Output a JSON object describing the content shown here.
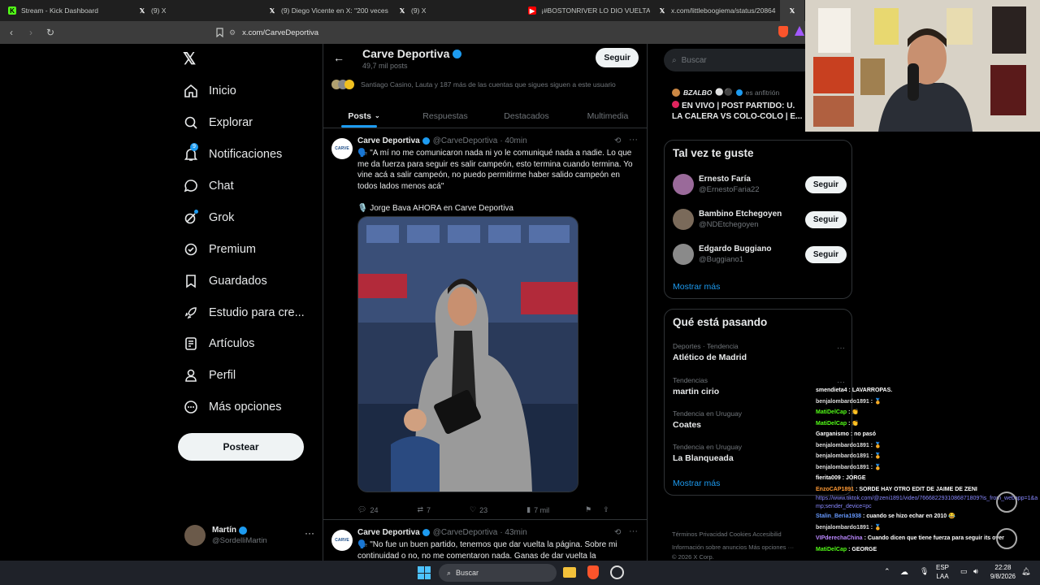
{
  "browser": {
    "tabs": [
      {
        "label": "Stream - Kick Dashboard",
        "icon": "K",
        "color": "#53fc18"
      },
      {
        "label": "(9) X",
        "icon": "X",
        "color": "#000000"
      },
      {
        "label": "(9) Diego Vicente en X: \"200 veces",
        "icon": "X",
        "color": "#000000"
      },
      {
        "label": "(9) X",
        "icon": "X",
        "color": "#000000"
      },
      {
        "label": "¡#BOSTONRIVER LO DIO VUELTA en",
        "icon": "▶",
        "color": "#ff0000"
      },
      {
        "label": "x.com/littleboogiema/status/20864",
        "icon": "X",
        "color": "#000000"
      }
    ],
    "url": "x.com/CarveDeportiva"
  },
  "nav": {
    "items": [
      {
        "label": "Inicio",
        "icon": "home-icon"
      },
      {
        "label": "Explorar",
        "icon": "search-icon"
      },
      {
        "label": "Notificaciones",
        "icon": "bell-icon"
      },
      {
        "label": "Chat",
        "icon": "chat-icon"
      },
      {
        "label": "Grok",
        "icon": "grok-icon"
      },
      {
        "label": "Premium",
        "icon": "premium-icon"
      },
      {
        "label": "Guardados",
        "icon": "bookmark-icon"
      },
      {
        "label": "Estudio para cre...",
        "icon": "rocket-icon"
      },
      {
        "label": "Artículos",
        "icon": "article-icon"
      },
      {
        "label": "Perfil",
        "icon": "person-icon"
      },
      {
        "label": "Más opciones",
        "icon": "more-icon"
      }
    ],
    "notif_badge": "9",
    "post_label": "Postear",
    "user_name": "Martín",
    "user_handle": "@SordelliMartin"
  },
  "profile": {
    "name": "Carve Deportiva",
    "posts_count": "49,7 mil posts",
    "follow_label": "Seguir",
    "followers_note": "Santiago Casino, Lauta y 187 más de las cuentas que sigues siguen a este usuario",
    "tabs": [
      "Posts",
      "Respuestas",
      "Destacados",
      "Multimedia"
    ]
  },
  "tweets": [
    {
      "name": "Carve Deportiva",
      "handle": "@CarveDeportiva",
      "time": "· 40min",
      "text": "🗣️ \"A mí no me comunicaron nada ni yo le comuniqué nada a nadie. Lo que me da fuerza para seguir es salir campeón, esto termina cuando termina. Yo vine acá a salir campeón, no puedo permitirme haber salido campeón en todos lados menos acá\"",
      "text2": "🎙️ Jorge Bava AHORA en Carve Deportiva",
      "replies": "24",
      "retweets": "7",
      "likes": "23",
      "views": "7 mil"
    },
    {
      "name": "Carve Deportiva",
      "handle": "@CarveDeportiva",
      "time": "· 43min",
      "text": "🗣️ \"No fue un buen partido, tenemos que dar vuelta la página. Sobre mi continuidad o no, no me comentaron nada. Ganas de dar vuelta la"
    }
  ],
  "sidebar": {
    "search_placeholder": "Buscar",
    "live": {
      "host": "BZALBO",
      "host_note": "es anfitrión",
      "title": "EN VIVO | POST PARTIDO: U. LA CALERA VS COLO-COLO | E..."
    },
    "suggestions_title": "Tal vez te guste",
    "suggestions": [
      {
        "name": "Ernesto Faría",
        "handle": "@ErnestoFaria22",
        "follow": "Seguir"
      },
      {
        "name": "Bambino Etchegoyen",
        "handle": "@NDEtchegoyen",
        "follow": "Seguir"
      },
      {
        "name": "Edgardo Buggiano",
        "handle": "@Buggiano1",
        "follow": "Seguir"
      }
    ],
    "show_more": "Mostrar más",
    "trends_title": "Qué está pasando",
    "trends": [
      {
        "category": "Deportes · Tendencia",
        "name": "Atlético de Madrid"
      },
      {
        "category": "Tendencias",
        "name": "martin cirio"
      },
      {
        "category": "Tendencia en Uruguay",
        "name": "Coates"
      },
      {
        "category": "Tendencia en Uruguay",
        "name": "La Blanqueada"
      }
    ],
    "footer_line1": "Términos   Privacidad   Cookies   Accesibilid",
    "footer_line2": "Información sobre anuncios   Más opciones ···",
    "footer_line3": "© 2026 X Corp."
  },
  "chat": [
    {
      "user": "smendieta4",
      "msg": "LAVARROPAS.",
      "color": "#ffffff"
    },
    {
      "user": "benjalombardo1891",
      "msg": "🏅",
      "color": "#dddddd"
    },
    {
      "user": "MatiDelCap",
      "msg": "👏",
      "color": "#53fc18"
    },
    {
      "user": "MatiDelCap",
      "msg": "👏",
      "color": "#53fc18"
    },
    {
      "user": "Garganismo",
      "msg": "no pasó",
      "color": "#ffffff"
    },
    {
      "user": "benjalombardo1891",
      "msg": "🏅",
      "color": "#dddddd"
    },
    {
      "user": "benjalombardo1891",
      "msg": "🏅",
      "color": "#dddddd"
    },
    {
      "user": "benjalombardo1891",
      "msg": "🏅",
      "color": "#dddddd"
    },
    {
      "user": "fierita009",
      "msg": "JORGE",
      "color": "#ffffff"
    },
    {
      "user": "EnzoCAP1891",
      "msg": "SORDE HAY OTRO EDIT DE JAIME DE ZENI",
      "color": "#ff9933"
    },
    {
      "user": "",
      "msg": "https://www.tiktok.com/@zeni1891/video/7666822931086871809?is_from_webapp=1&amp;sender_device=pc",
      "color": "#8888ff"
    },
    {
      "user": "Stalin_Beria1938",
      "msg": "cuando se hizo echar en 2010 😂",
      "color": "#6699ff"
    },
    {
      "user": "benjalombardo1891",
      "msg": "🏅",
      "color": "#dddddd"
    },
    {
      "user": "VIPderechaChina",
      "msg": "Cuando dicen que tiene fuerza para seguir its over",
      "color": "#bb88ff"
    },
    {
      "user": "MatiDelCap",
      "msg": "GEORGE",
      "color": "#53fc18"
    }
  ],
  "taskbar": {
    "search": "Buscar",
    "lang1": "ESP",
    "lang2": "LAA",
    "time": "22:28",
    "date": "9/8/2026"
  }
}
